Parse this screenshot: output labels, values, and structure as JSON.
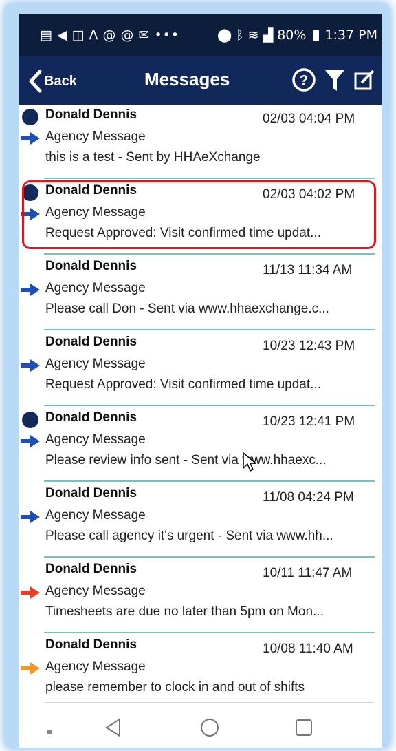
{
  "status_bar": {
    "battery": "80%",
    "time": "1:37 PM"
  },
  "header": {
    "back_label": "Back",
    "title": "Messages",
    "colors": {
      "header_bg": "#11285a",
      "status_bg": "#0c1e3c"
    }
  },
  "messages": [
    {
      "sender": "Donald Dennis",
      "time": "02/03 04:04 PM",
      "type": "Agency Message",
      "preview": "this is a test - Sent by HHAeXchange",
      "unread": true,
      "arrow_color": "#1f4fb5"
    },
    {
      "sender": "Donald Dennis",
      "time": "02/03 04:02 PM",
      "type": "Agency Message",
      "preview": "Request Approved: Visit confirmed time updat...",
      "unread": true,
      "arrow_color": "#1f4fb5"
    },
    {
      "sender": "Donald Dennis",
      "time": "11/13 11:34 AM",
      "type": "Agency Message",
      "preview": "Please call Don - Sent via www.hhaexchange.c...",
      "unread": false,
      "arrow_color": "#1f4fb5"
    },
    {
      "sender": "Donald Dennis",
      "time": "10/23 12:43 PM",
      "type": "Agency Message",
      "preview": "Request Approved: Visit confirmed time updat...",
      "unread": false,
      "arrow_color": "#1f4fb5"
    },
    {
      "sender": "Donald Dennis",
      "time": "10/23 12:41 PM",
      "type": "Agency Message",
      "preview": "Please review info sent - Sent via www.hhaexc...",
      "unread": true,
      "arrow_color": "#1f4fb5"
    },
    {
      "sender": "Donald Dennis",
      "time": "11/08 04:24 PM",
      "type": "Agency Message",
      "preview": "Please call agency it's urgent - Sent via www.hh...",
      "unread": false,
      "arrow_color": "#1f4fb5"
    },
    {
      "sender": "Donald Dennis",
      "time": "10/11 11:47 AM",
      "type": "Agency Message",
      "preview": "Timesheets are due no later than 5pm on Mon...",
      "unread": false,
      "arrow_color": "#e8402a"
    },
    {
      "sender": "Donald Dennis",
      "time": "10/08 11:40 AM",
      "type": "Agency Message",
      "preview": "please remember to clock in and out of shifts",
      "unread": false,
      "arrow_color": "#f0962a"
    }
  ],
  "icons": {
    "back": "chevron-left-icon",
    "help": "help-icon",
    "filter": "filter-icon",
    "compose": "compose-icon",
    "nav": [
      "recents-dot-icon",
      "back-triangle-icon",
      "home-circle-icon",
      "overview-square-icon"
    ]
  }
}
